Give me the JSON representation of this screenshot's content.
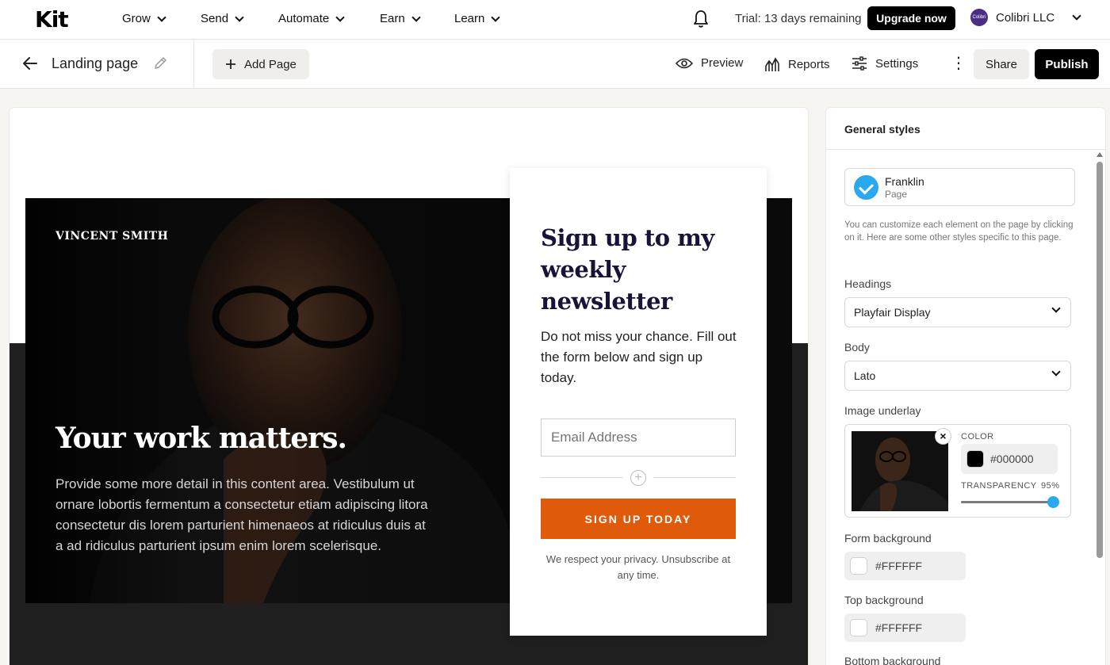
{
  "topnav": {
    "logo": "Kit",
    "menu": [
      {
        "label": "Grow"
      },
      {
        "label": "Send"
      },
      {
        "label": "Automate"
      },
      {
        "label": "Earn"
      },
      {
        "label": "Learn"
      }
    ],
    "trial_text": "Trial: 13 days remaining",
    "upgrade_label": "Upgrade now",
    "account_name": "Colibri LLC",
    "avatar_text": "Colibri"
  },
  "toolbar": {
    "page_title": "Landing page",
    "add_page_label": "Add Page",
    "preview_label": "Preview",
    "reports_label": "Reports",
    "settings_label": "Settings",
    "more_label": "⋮",
    "share_label": "Share",
    "publish_label": "Publish"
  },
  "landing": {
    "author": "VINCENT SMITH",
    "headline": "Your work matters.",
    "body": "Provide some more detail in this content area. Vestibulum ut ornare lobortis fermentum a consectetur etiam adipiscing litora consectetur dis lorem parturient himenaeos at ridiculus duis at a ad ridiculus parturient ipsum enim lorem scelerisque.",
    "form": {
      "title": "Sign up to my weekly newsletter",
      "description": "Do not miss your chance. Fill out the form below and sign up today.",
      "email_placeholder": "Email Address",
      "button_label": "SIGN UP TODAY",
      "privacy": "We respect your privacy. Unsubscribe at any time."
    }
  },
  "panel": {
    "title": "General styles",
    "theme_name": "Franklin",
    "theme_type": "Page",
    "help_text": "You can customize each element on the page by clicking on it. Here are some other styles specific to this page.",
    "headings_label": "Headings",
    "headings_value": "Playfair Display",
    "body_label": "Body",
    "body_value": "Lato",
    "underlay_label": "Image underlay",
    "color_label": "COLOR",
    "color_value": "#000000",
    "transparency_label": "TRANSPARENCY",
    "transparency_value": "95%",
    "transparency_fraction": 0.95,
    "form_bg_label": "Form background",
    "form_bg_value": "#FFFFFF",
    "top_bg_label": "Top background",
    "top_bg_value": "#FFFFFF",
    "bottom_bg_label": "Bottom background"
  },
  "colors": {
    "accent_orange": "#e05a0c",
    "accent_blue": "#2aa9f0",
    "underlay_color": "#000000",
    "form_bg": "#FFFFFF",
    "top_bg": "#FFFFFF"
  },
  "icons": [
    "chevron-down-icon",
    "bell-icon",
    "arrow-left-icon",
    "pencil-icon",
    "plus-icon",
    "eye-icon",
    "chart-icon",
    "sliders-icon",
    "kebab-icon",
    "check-icon",
    "close-icon",
    "plus-circle-icon"
  ]
}
